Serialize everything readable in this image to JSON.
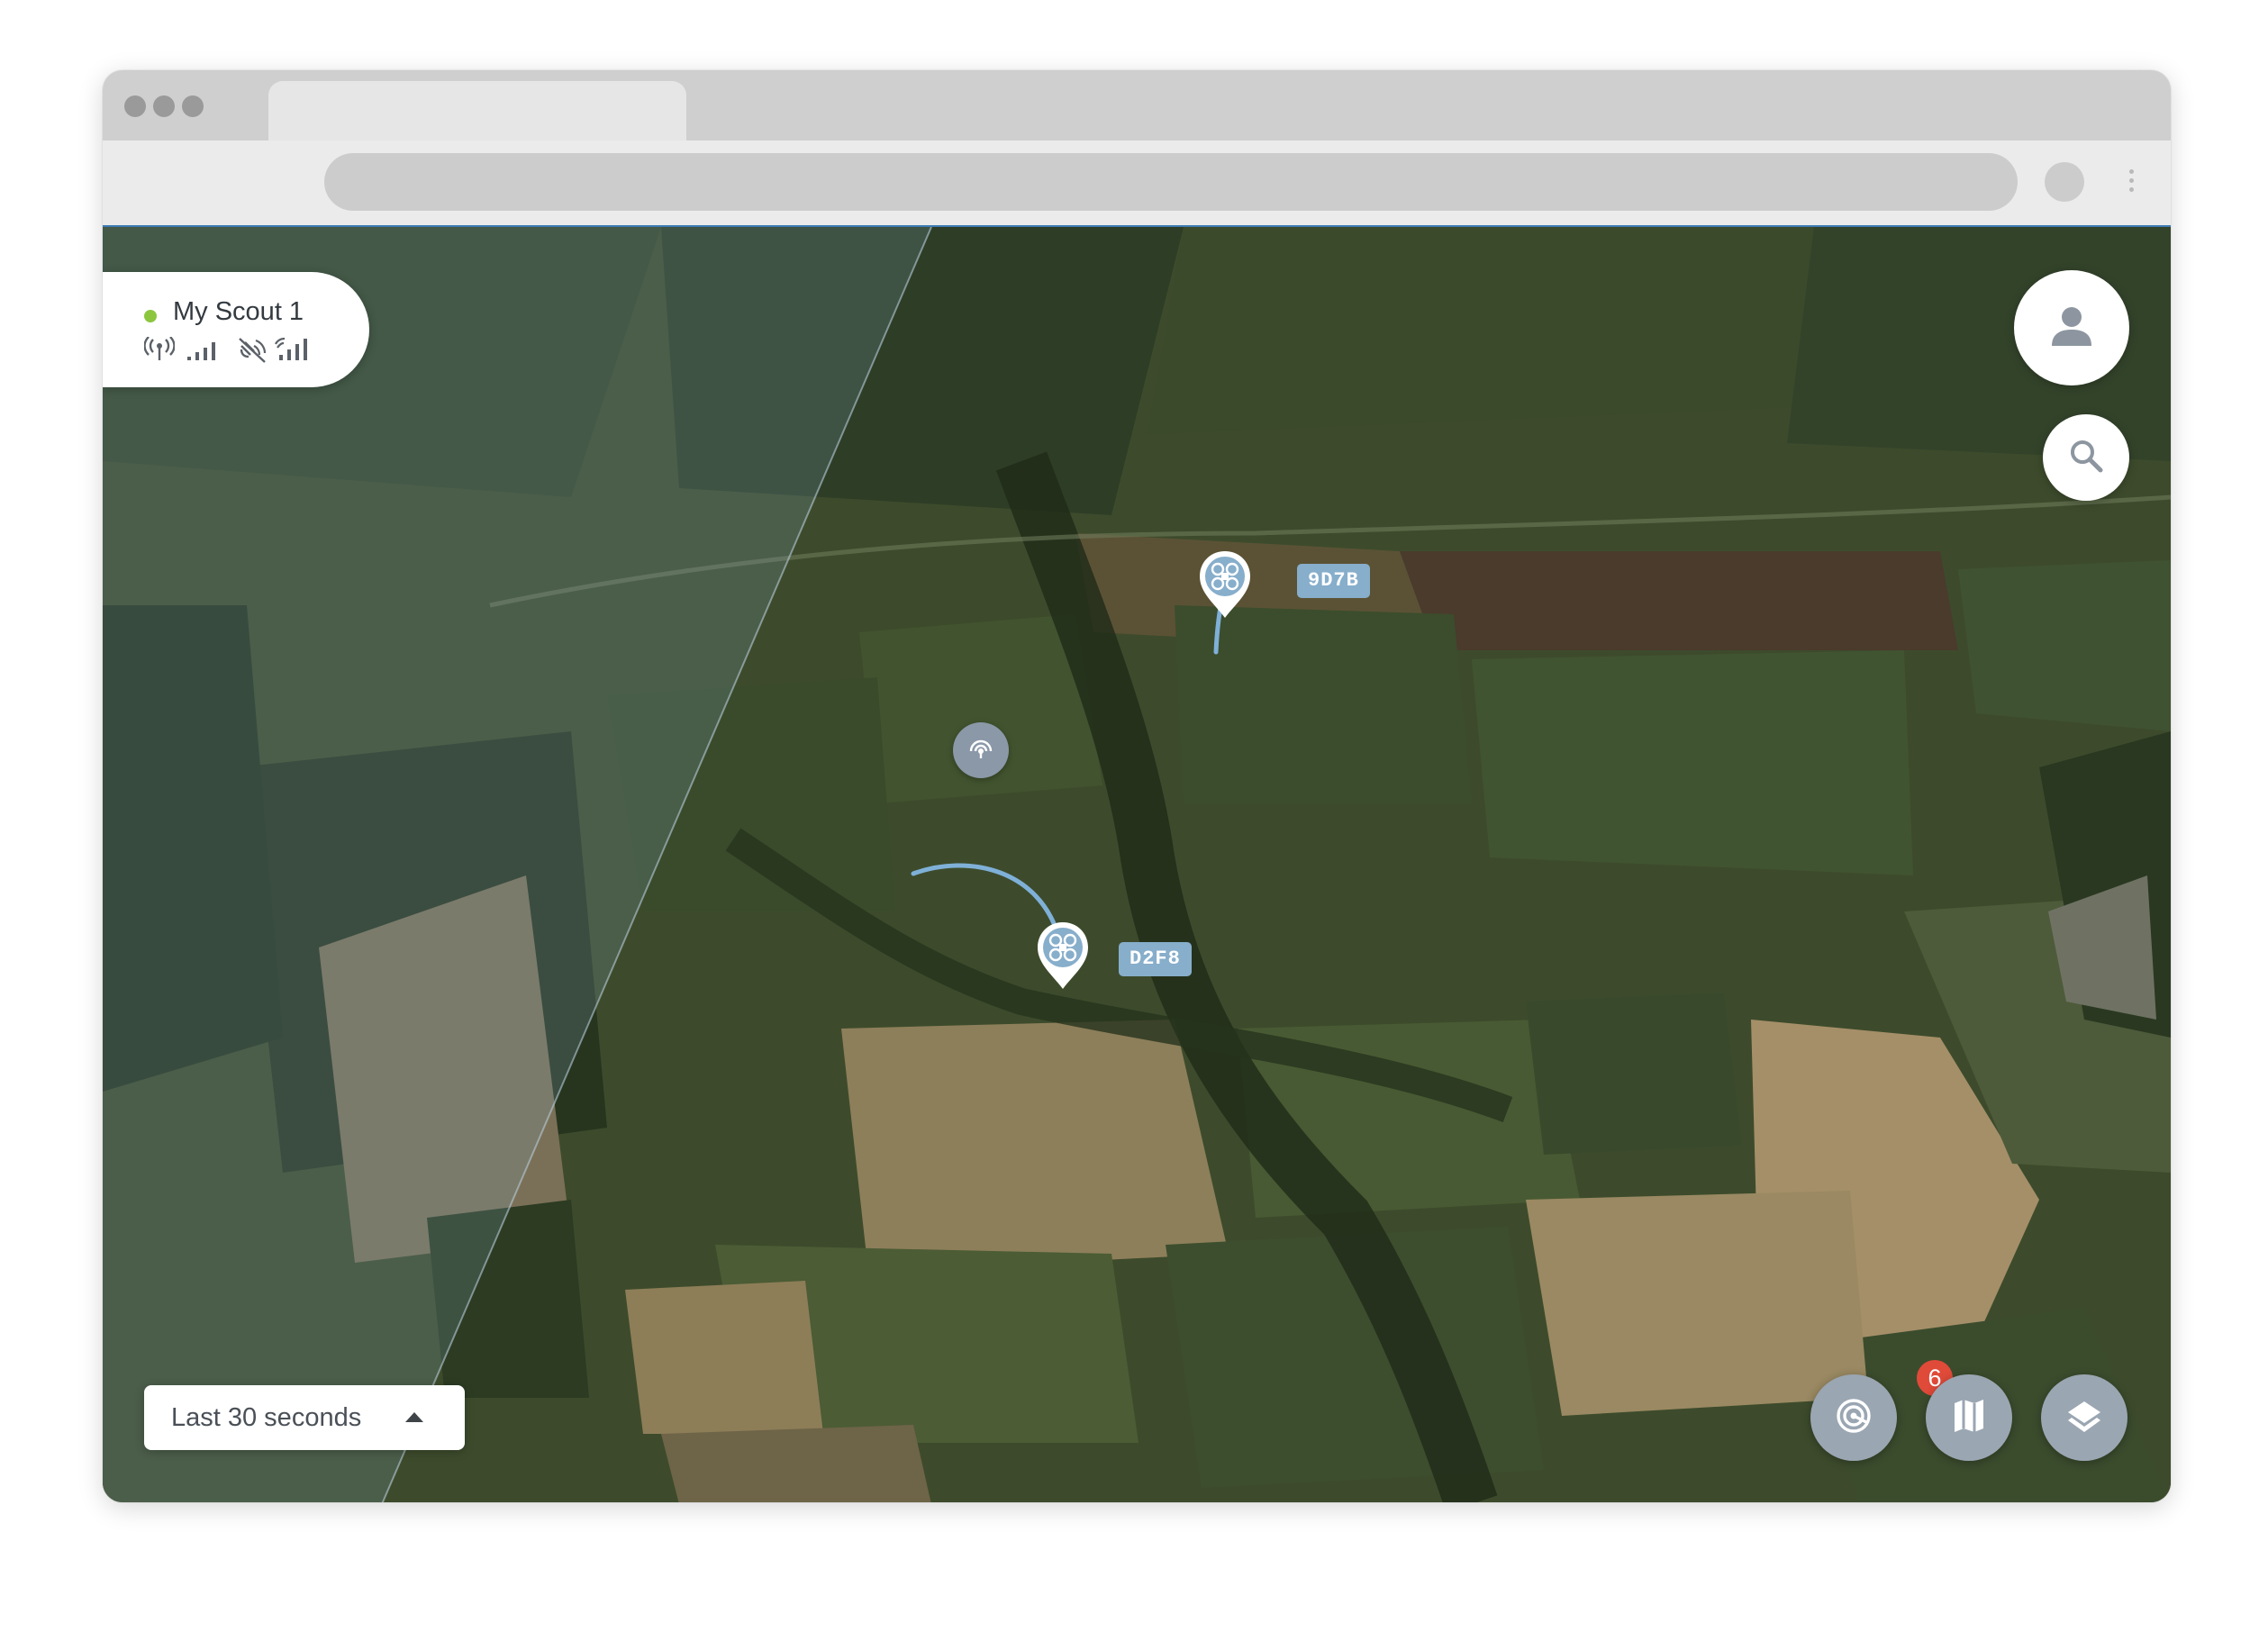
{
  "scout": {
    "name": "My Scout 1",
    "status": "online",
    "status_color": "#8cc63f",
    "icons": [
      "radio-signal-icon",
      "signal-bars-icon",
      "satellite-off-icon",
      "satellite-signal-icon"
    ]
  },
  "drones": [
    {
      "id": "9D7B",
      "icon": "drone-icon"
    },
    {
      "id": "D2F8",
      "icon": "drone-icon"
    }
  ],
  "sensor": {
    "icon": "sensor-radar-icon"
  },
  "time_filter": {
    "label": "Last 30 seconds"
  },
  "controls": {
    "profile_icon": "user-icon",
    "search_icon": "search-icon",
    "detections_icon": "detections-icon",
    "detections_count": "6",
    "map_icon": "map-icon",
    "layers_icon": "layers-icon"
  },
  "colors": {
    "accent_blue": "#87aecb",
    "badge_red": "#e04a39",
    "map_control_grey": "#9aa6b2"
  }
}
